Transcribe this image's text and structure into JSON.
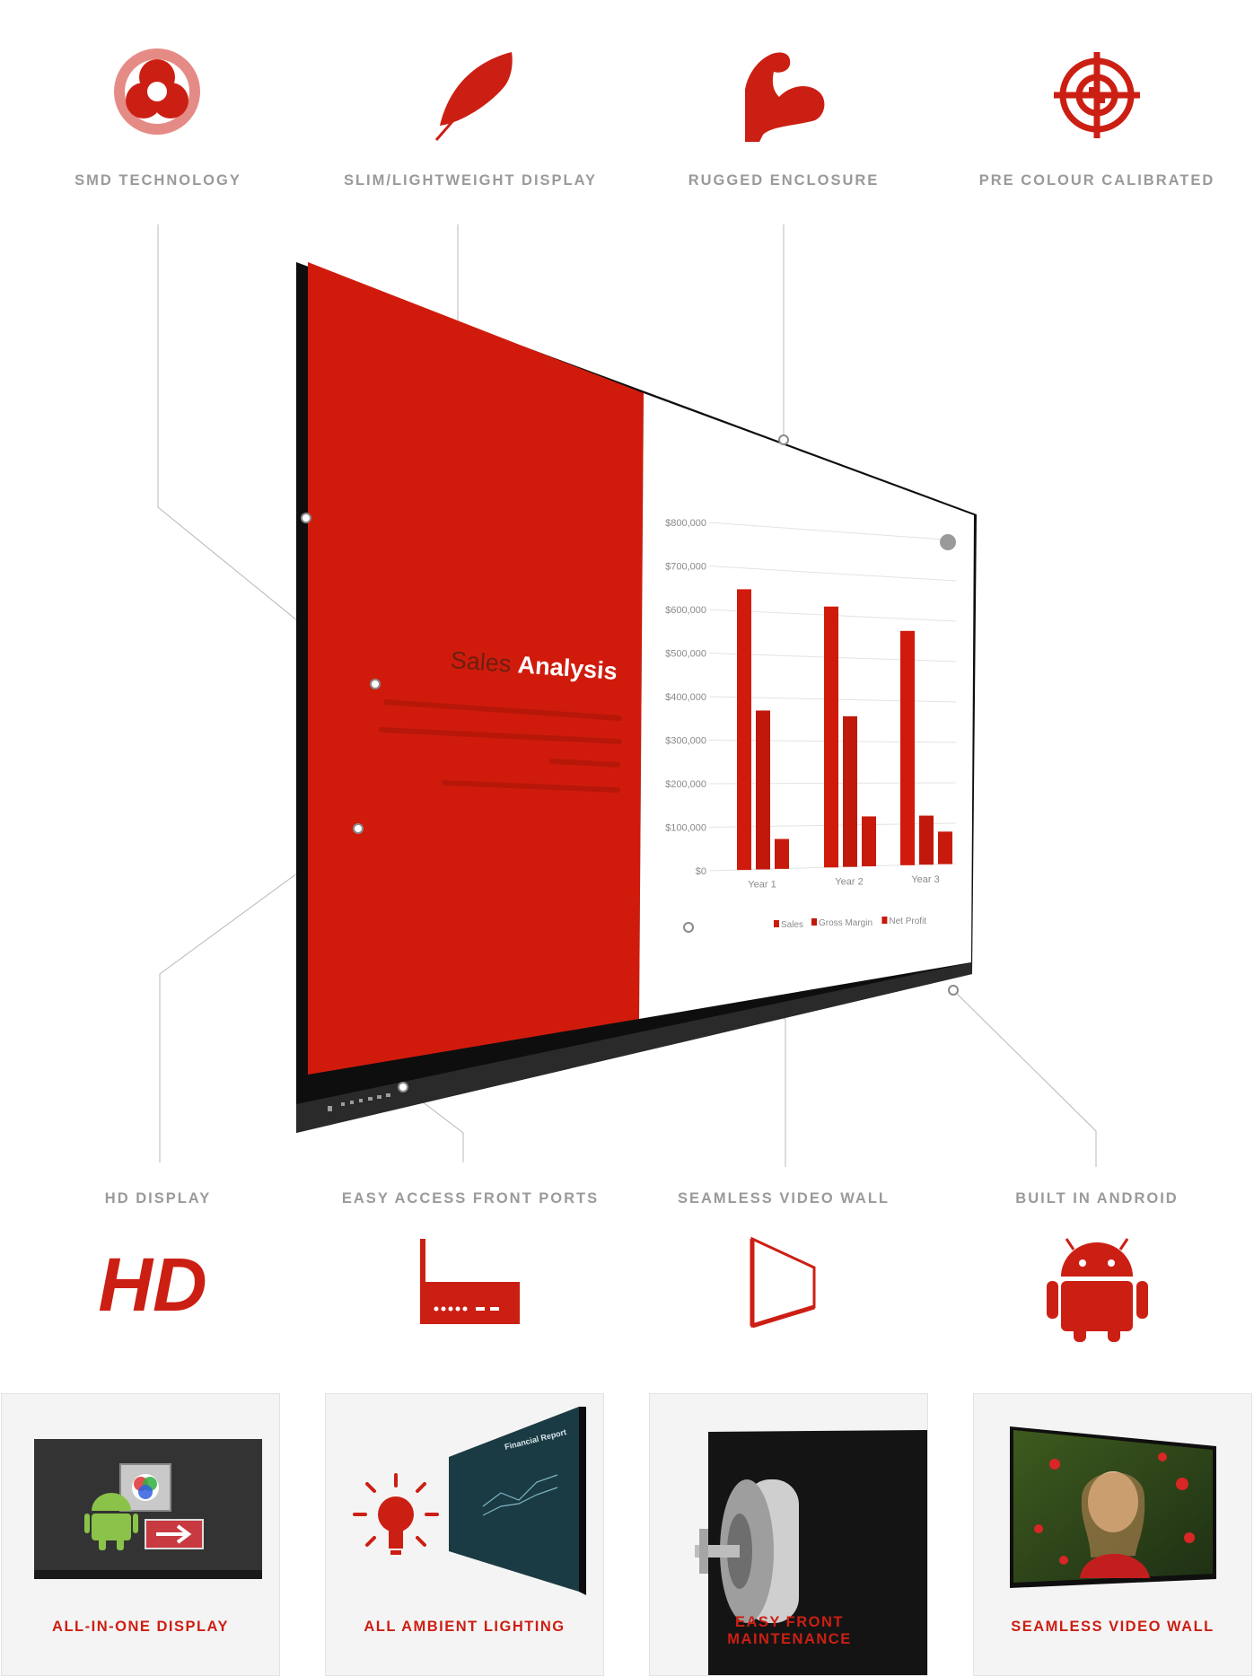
{
  "top_features": [
    {
      "label": "SMD TECHNOLOGY",
      "icon": "smd-technology-icon"
    },
    {
      "label": "SLIM/LIGHTWEIGHT DISPLAY",
      "icon": "feather-icon"
    },
    {
      "label": "RUGGED ENCLOSURE",
      "icon": "flexed-arm-icon"
    },
    {
      "label": "PRE COLOUR CALIBRATED",
      "icon": "crosshair-target-icon"
    }
  ],
  "bottom_features": [
    {
      "label": "HD DISPLAY",
      "icon": "hd-icon"
    },
    {
      "label": "EASY ACCESS FRONT PORTS",
      "icon": "front-ports-icon"
    },
    {
      "label": "SEAMLESS VIDEO WALL",
      "icon": "video-wall-panel-icon"
    },
    {
      "label": "BUILT IN ANDROID",
      "icon": "android-icon"
    }
  ],
  "screen": {
    "title_part1": "Sales",
    "title_part2": "Analysis",
    "y_ticks": [
      "$800,000",
      "$700,000",
      "$600,000",
      "$500,000",
      "$400,000",
      "$300,000",
      "$200,000",
      "$100,000",
      "$0"
    ],
    "x_labels": [
      "Year 1",
      "Year 2",
      "Year 3"
    ],
    "legend": [
      "Sales",
      "Gross Margin",
      "Net Profit"
    ]
  },
  "chart_data": {
    "type": "bar",
    "categories": [
      "Year 1",
      "Year 2",
      "Year 3"
    ],
    "series": [
      {
        "name": "Sales",
        "values": [
          650000,
          620000,
          570000
        ]
      },
      {
        "name": "Gross Margin",
        "values": [
          370000,
          360000,
          120000
        ]
      },
      {
        "name": "Net Profit",
        "values": [
          70000,
          120000,
          80000
        ]
      }
    ],
    "ylim": [
      0,
      800000
    ],
    "title": "",
    "xlabel": "",
    "ylabel": "",
    "grid": true,
    "legend_position": "bottom"
  },
  "cards": [
    {
      "label": "ALL-IN-ONE DISPLAY"
    },
    {
      "label": "ALL AMBIENT LIGHTING",
      "screen_title": "Financial Report"
    },
    {
      "label": "EASY FRONT MAINTENANCE"
    },
    {
      "label": "SEAMLESS VIDEO WALL"
    }
  ],
  "colors": {
    "accent": "#cc1f14",
    "label_gray": "#9a9a9a",
    "panel_black": "#121212"
  }
}
